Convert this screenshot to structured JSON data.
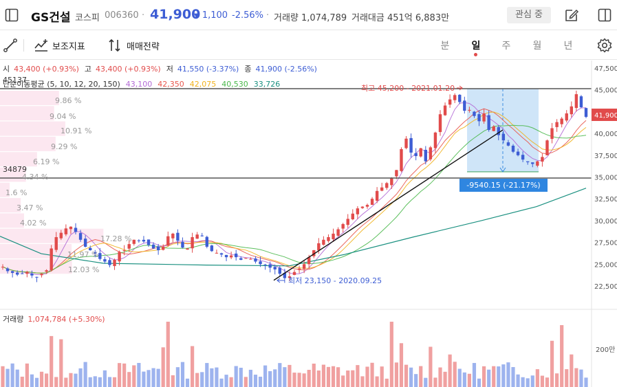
{
  "header": {
    "stock_name": "GS건설",
    "market": "코스피",
    "code": "006360",
    "price": "41,900",
    "change_arrow": "▼",
    "change": "1,100",
    "change_pct": "-2.56%",
    "volume": "거래량 1,074,789",
    "amount": "거래대금 451억 6,883만",
    "favorite_label": "관심 중"
  },
  "toolbar": {
    "indicator_label": "보조지표",
    "strategy_label": "매매전략",
    "periods": [
      "분",
      "일",
      "주",
      "월",
      "년"
    ],
    "active_period": "일"
  },
  "ohlc": {
    "open_label": "시",
    "open": "43,400 (+0.93%)",
    "high_label": "고",
    "high": "43,400 (+0.93%)",
    "low_label": "저",
    "low": "41,550 (-3.37%)",
    "close_label": "종",
    "close": "41,900 (-2.56%)"
  },
  "ma": {
    "label": "단순이동평균 (5, 10, 12, 20, 150)",
    "values": [
      {
        "value": "43,100",
        "color": "#b46bd6"
      },
      {
        "value": "42,350",
        "color": "#e8564c"
      },
      {
        "value": "42,075",
        "color": "#f1b21c"
      },
      {
        "value": "40,530",
        "color": "#49b84a"
      },
      {
        "value": "33,726",
        "color": "#1a9080"
      }
    ]
  },
  "colors": {
    "up": "#e14b4b",
    "down": "#3d5dd4",
    "accent": "#3d5dd4",
    "price_tag": "#e14b4b",
    "measure_bg": "#2f86e0"
  },
  "price_axis": [
    "47,500",
    "45,000",
    "42,500",
    "40,000",
    "37,500",
    "35,000",
    "32,500",
    "30,000",
    "27,500",
    "25,000",
    "22,500"
  ],
  "current_price_tag": "41,900",
  "hlines": [
    {
      "label": "45137"
    },
    {
      "label": "34879"
    }
  ],
  "volume_profile": [
    {
      "label": "9.86 %",
      "pct": 9.86
    },
    {
      "label": "9.04 %",
      "pct": 9.04
    },
    {
      "label": "10.91 %",
      "pct": 10.91
    },
    {
      "label": "9.29 %",
      "pct": 9.29
    },
    {
      "label": "6.19 %",
      "pct": 6.19
    },
    {
      "label": "4.34 %",
      "pct": 4.34
    },
    {
      "label": "1.6 %",
      "pct": 1.6
    },
    {
      "label": "3.47 %",
      "pct": 3.47
    },
    {
      "label": "4.02 %",
      "pct": 4.02
    },
    {
      "label": "17.28 %",
      "pct": 17.28
    },
    {
      "label": "11.97 %",
      "pct": 11.97
    },
    {
      "label": "12.03 %",
      "pct": 12.03
    }
  ],
  "annotations": {
    "high": "최고 45,200 - 2021.01.20",
    "low": "최저 23,150 - 2020.09.25",
    "measure": "-9540.15 (-21.17%)"
  },
  "volume_panel": {
    "label": "거래량",
    "value": "1,074,784 (+5.30%)",
    "axis_label": "200만"
  },
  "chart_data": {
    "type": "candlestick",
    "closes": [
      24700,
      24200,
      24000,
      23800,
      23900,
      24100,
      23700,
      23500,
      23900,
      24300,
      26800,
      28100,
      28600,
      29100,
      29300,
      28700,
      27800,
      27000,
      26600,
      26200,
      25600,
      25300,
      24900,
      25500,
      26400,
      26600,
      27300,
      27800,
      27700,
      27600,
      27200,
      26800,
      26600,
      27000,
      28200,
      28500,
      27700,
      26900,
      26800,
      28100,
      28400,
      28200,
      27000,
      26500,
      26300,
      26100,
      25800,
      26000,
      25800,
      25500,
      25700,
      25600,
      25300,
      25000,
      24900,
      24600,
      24400,
      23900,
      23400,
      23600,
      24100,
      24500,
      25000,
      25800,
      26600,
      27400,
      27800,
      28100,
      28500,
      29000,
      29600,
      30200,
      30800,
      31400,
      31600,
      31800,
      32500,
      33400,
      33800,
      34300,
      34900,
      35800,
      38200,
      39400,
      37800,
      37400,
      38300,
      36800,
      38400,
      40100,
      42200,
      43200,
      43900,
      44400,
      43600,
      42600,
      42700,
      42000,
      41400,
      42300,
      40400,
      40800,
      39800,
      39200,
      38600,
      37900,
      37500,
      37000,
      36700,
      36500,
      36800,
      37300,
      39200,
      40600,
      41300,
      41700,
      42300,
      43100,
      44500,
      43000,
      41900
    ],
    "measure": {
      "from": 45137,
      "to": 35597,
      "change": -9540.15,
      "change_pct": -21.17
    },
    "y_range": [
      21000,
      48000
    ]
  }
}
